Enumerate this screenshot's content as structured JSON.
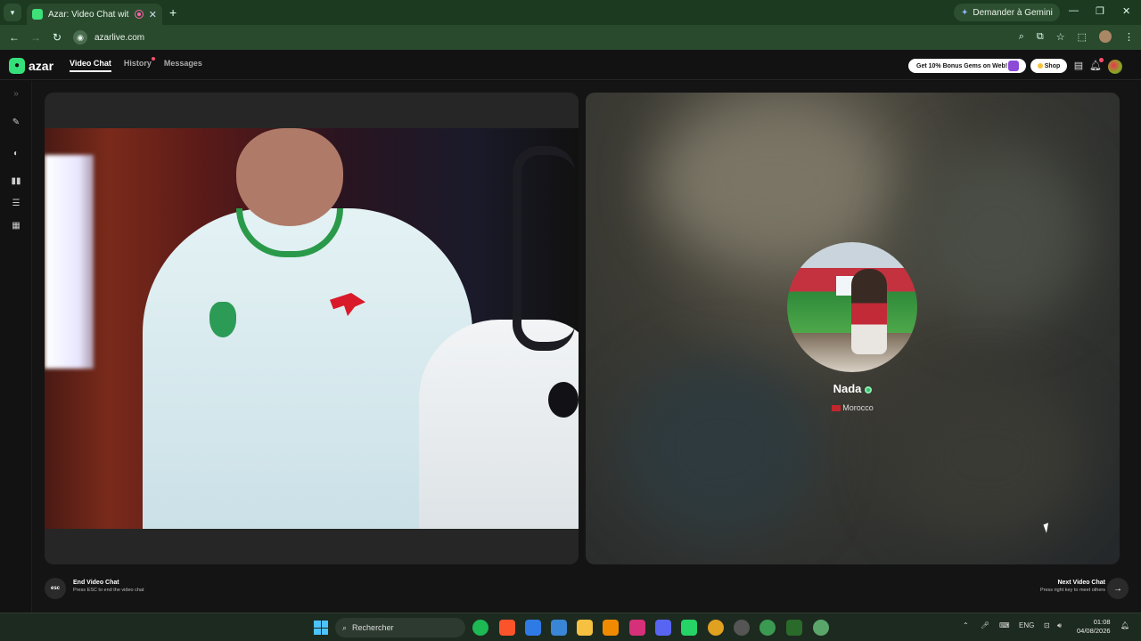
{
  "browser": {
    "tab_title": "Azar: Video Chat with New",
    "new_tab_icon": "plus-icon",
    "gemini_label": "Demander à Gemini",
    "url": "azarlive.com"
  },
  "app": {
    "logo_text": "azar",
    "nav": [
      {
        "label": "Video Chat",
        "active": true
      },
      {
        "label": "History",
        "active": false,
        "has_dot": true
      },
      {
        "label": "Messages",
        "active": false
      }
    ],
    "promo_label": "Get 10% Bonus Gems on Web!",
    "shop_label": "Shop"
  },
  "match": {
    "name": "Nada",
    "online": true,
    "country": "Morocco"
  },
  "footer": {
    "esc_key": "esc",
    "end_title": "End Video Chat",
    "end_hint": "Press ESC to end the video chat",
    "next_title": "Next Video Chat",
    "next_hint": "Press right key to meet others",
    "next_icon": "arrow-right-icon"
  },
  "taskbar": {
    "search_placeholder": "Rechercher",
    "language": "ENG",
    "time": "01:08",
    "date": "04/08/2026"
  },
  "colors": {
    "accent": "#35e07a",
    "chrome_dark": "#1c3a20",
    "online": "#35c06a"
  }
}
